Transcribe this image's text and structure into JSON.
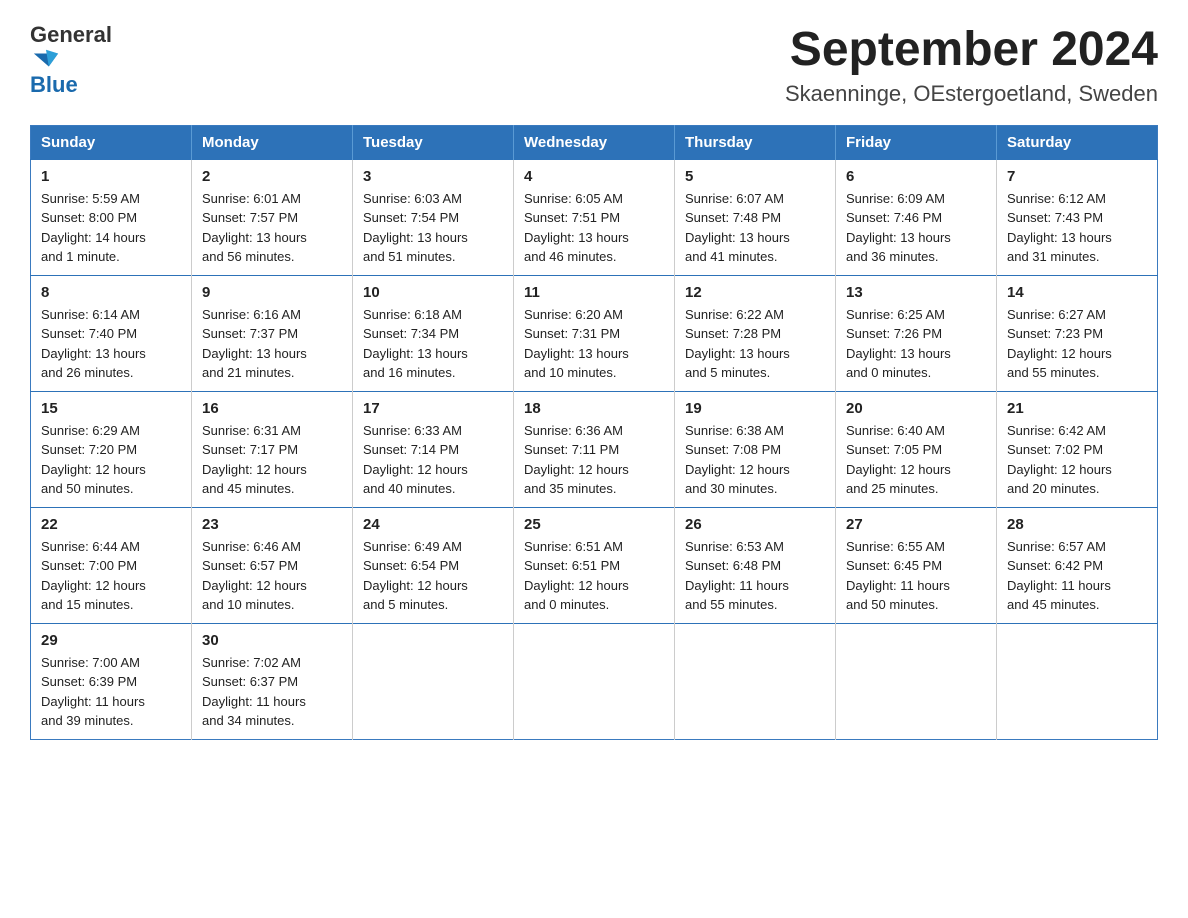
{
  "header": {
    "logo_general": "General",
    "logo_blue": "Blue",
    "month_year": "September 2024",
    "location": "Skaenninge, OEstergoetland, Sweden"
  },
  "days_of_week": [
    "Sunday",
    "Monday",
    "Tuesday",
    "Wednesday",
    "Thursday",
    "Friday",
    "Saturday"
  ],
  "weeks": [
    [
      {
        "day": "1",
        "sunrise": "5:59 AM",
        "sunset": "8:00 PM",
        "daylight": "14 hours and 1 minute."
      },
      {
        "day": "2",
        "sunrise": "6:01 AM",
        "sunset": "7:57 PM",
        "daylight": "13 hours and 56 minutes."
      },
      {
        "day": "3",
        "sunrise": "6:03 AM",
        "sunset": "7:54 PM",
        "daylight": "13 hours and 51 minutes."
      },
      {
        "day": "4",
        "sunrise": "6:05 AM",
        "sunset": "7:51 PM",
        "daylight": "13 hours and 46 minutes."
      },
      {
        "day": "5",
        "sunrise": "6:07 AM",
        "sunset": "7:48 PM",
        "daylight": "13 hours and 41 minutes."
      },
      {
        "day": "6",
        "sunrise": "6:09 AM",
        "sunset": "7:46 PM",
        "daylight": "13 hours and 36 minutes."
      },
      {
        "day": "7",
        "sunrise": "6:12 AM",
        "sunset": "7:43 PM",
        "daylight": "13 hours and 31 minutes."
      }
    ],
    [
      {
        "day": "8",
        "sunrise": "6:14 AM",
        "sunset": "7:40 PM",
        "daylight": "13 hours and 26 minutes."
      },
      {
        "day": "9",
        "sunrise": "6:16 AM",
        "sunset": "7:37 PM",
        "daylight": "13 hours and 21 minutes."
      },
      {
        "day": "10",
        "sunrise": "6:18 AM",
        "sunset": "7:34 PM",
        "daylight": "13 hours and 16 minutes."
      },
      {
        "day": "11",
        "sunrise": "6:20 AM",
        "sunset": "7:31 PM",
        "daylight": "13 hours and 10 minutes."
      },
      {
        "day": "12",
        "sunrise": "6:22 AM",
        "sunset": "7:28 PM",
        "daylight": "13 hours and 5 minutes."
      },
      {
        "day": "13",
        "sunrise": "6:25 AM",
        "sunset": "7:26 PM",
        "daylight": "13 hours and 0 minutes."
      },
      {
        "day": "14",
        "sunrise": "6:27 AM",
        "sunset": "7:23 PM",
        "daylight": "12 hours and 55 minutes."
      }
    ],
    [
      {
        "day": "15",
        "sunrise": "6:29 AM",
        "sunset": "7:20 PM",
        "daylight": "12 hours and 50 minutes."
      },
      {
        "day": "16",
        "sunrise": "6:31 AM",
        "sunset": "7:17 PM",
        "daylight": "12 hours and 45 minutes."
      },
      {
        "day": "17",
        "sunrise": "6:33 AM",
        "sunset": "7:14 PM",
        "daylight": "12 hours and 40 minutes."
      },
      {
        "day": "18",
        "sunrise": "6:36 AM",
        "sunset": "7:11 PM",
        "daylight": "12 hours and 35 minutes."
      },
      {
        "day": "19",
        "sunrise": "6:38 AM",
        "sunset": "7:08 PM",
        "daylight": "12 hours and 30 minutes."
      },
      {
        "day": "20",
        "sunrise": "6:40 AM",
        "sunset": "7:05 PM",
        "daylight": "12 hours and 25 minutes."
      },
      {
        "day": "21",
        "sunrise": "6:42 AM",
        "sunset": "7:02 PM",
        "daylight": "12 hours and 20 minutes."
      }
    ],
    [
      {
        "day": "22",
        "sunrise": "6:44 AM",
        "sunset": "7:00 PM",
        "daylight": "12 hours and 15 minutes."
      },
      {
        "day": "23",
        "sunrise": "6:46 AM",
        "sunset": "6:57 PM",
        "daylight": "12 hours and 10 minutes."
      },
      {
        "day": "24",
        "sunrise": "6:49 AM",
        "sunset": "6:54 PM",
        "daylight": "12 hours and 5 minutes."
      },
      {
        "day": "25",
        "sunrise": "6:51 AM",
        "sunset": "6:51 PM",
        "daylight": "12 hours and 0 minutes."
      },
      {
        "day": "26",
        "sunrise": "6:53 AM",
        "sunset": "6:48 PM",
        "daylight": "11 hours and 55 minutes."
      },
      {
        "day": "27",
        "sunrise": "6:55 AM",
        "sunset": "6:45 PM",
        "daylight": "11 hours and 50 minutes."
      },
      {
        "day": "28",
        "sunrise": "6:57 AM",
        "sunset": "6:42 PM",
        "daylight": "11 hours and 45 minutes."
      }
    ],
    [
      {
        "day": "29",
        "sunrise": "7:00 AM",
        "sunset": "6:39 PM",
        "daylight": "11 hours and 39 minutes."
      },
      {
        "day": "30",
        "sunrise": "7:02 AM",
        "sunset": "6:37 PM",
        "daylight": "11 hours and 34 minutes."
      },
      null,
      null,
      null,
      null,
      null
    ]
  ],
  "labels": {
    "sunrise": "Sunrise:",
    "sunset": "Sunset:",
    "daylight": "Daylight:"
  }
}
